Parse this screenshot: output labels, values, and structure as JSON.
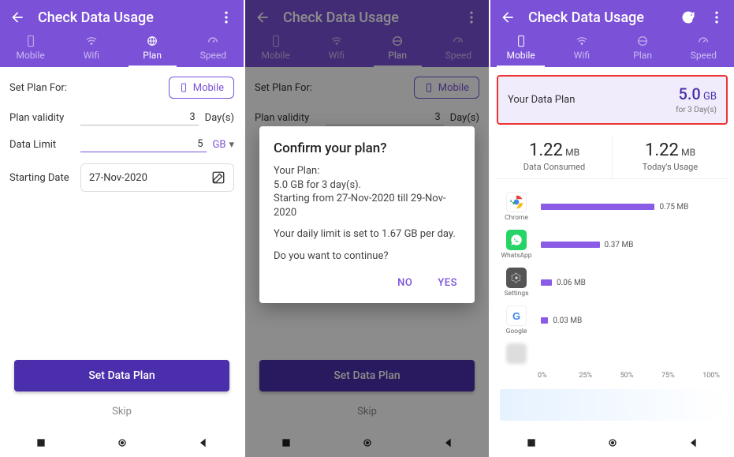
{
  "colors": {
    "primary": "#7b51d8",
    "primaryDark": "#4b2eab",
    "highlight": "#e33"
  },
  "header": {
    "title": "Check Data Usage"
  },
  "tabs": [
    {
      "label": "Mobile"
    },
    {
      "label": "Wifi"
    },
    {
      "label": "Plan"
    },
    {
      "label": "Speed"
    }
  ],
  "planForm": {
    "setFor": {
      "label": "Set Plan For:",
      "chip": "Mobile"
    },
    "validity": {
      "label": "Plan validity",
      "value": "3",
      "unit": "Day(s)"
    },
    "limit": {
      "label": "Data Limit",
      "value": "5",
      "unit": "GB"
    },
    "start": {
      "label": "Starting Date",
      "value": "27-Nov-2020"
    },
    "submit": "Set Data Plan",
    "skip": "Skip"
  },
  "dialog": {
    "title": "Confirm your plan?",
    "line1": "Your Plan:",
    "line2": "5.0 GB for 3 day(s).",
    "line3": "Starting from 27-Nov-2020 till 29-Nov-2020",
    "dailyLimit": "Your daily limit is set to 1.67 GB per day.",
    "question": "Do you want to continue?",
    "no": "NO",
    "yes": "YES"
  },
  "overview": {
    "planLabel": "Your Data Plan",
    "planValue": "5.0",
    "planUnit": "GB",
    "planSub": "for 3 Day(s)",
    "consumed": {
      "value": "1.22",
      "unit": "MB",
      "label": "Data Consumed"
    },
    "today": {
      "value": "1.22",
      "unit": "MB",
      "label": "Today's Usage"
    },
    "apps": [
      {
        "name": "Chrome",
        "value": "0.75 MB",
        "pct": 62
      },
      {
        "name": "WhatsApp",
        "value": "0.37 MB",
        "pct": 32
      },
      {
        "name": "Settings",
        "value": "0.06 MB",
        "pct": 6
      },
      {
        "name": "Google",
        "value": "0.03 MB",
        "pct": 4
      }
    ],
    "axis": [
      "0%",
      "25%",
      "50%",
      "75%",
      "100%"
    ]
  }
}
